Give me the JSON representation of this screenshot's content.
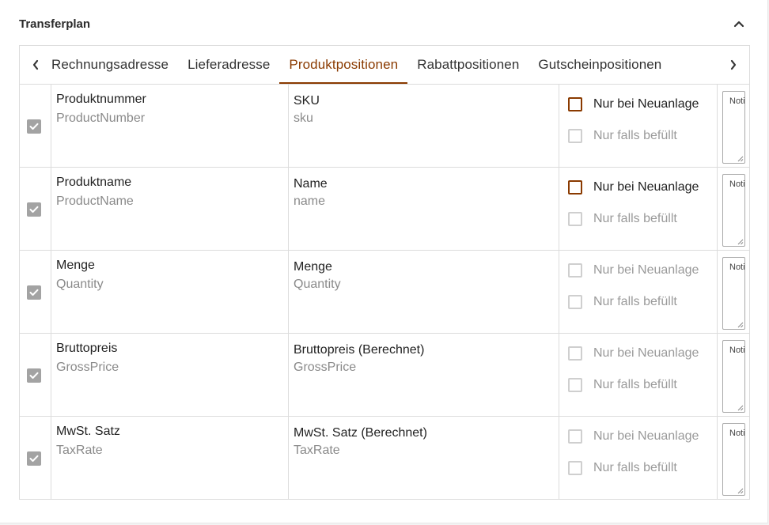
{
  "panel": {
    "title": "Transferplan"
  },
  "tabs": {
    "items": [
      {
        "label": "Rechnungsadresse",
        "active": false
      },
      {
        "label": "Lieferadresse",
        "active": false
      },
      {
        "label": "Produktpositionen",
        "active": true
      },
      {
        "label": "Rabattpositionen",
        "active": false
      },
      {
        "label": "Gutscheinpositionen",
        "active": false
      }
    ]
  },
  "icons": {
    "collapse": "chevron-up-icon",
    "tabs_prev": "chevron-left-icon",
    "tabs_next": "chevron-right-icon",
    "row_check": "checkmark-icon"
  },
  "colors": {
    "accent": "#8a3a00",
    "disabled_check": "#a3a3a3",
    "muted_text": "#8a8a8a",
    "border": "#dcdcdc"
  },
  "rows": [
    {
      "source_label": "Produktnummer",
      "source_key": "ProductNumber",
      "target_label": "SKU",
      "target_key": "sku",
      "opt_new_label": "Nur bei Neuanlage",
      "opt_new_enabled": true,
      "opt_filled_label": "Nur falls befüllt",
      "note_text": "Notiz"
    },
    {
      "source_label": "Produktname",
      "source_key": "ProductName",
      "target_label": "Name",
      "target_key": "name",
      "opt_new_label": "Nur bei Neuanlage",
      "opt_new_enabled": true,
      "opt_filled_label": "Nur falls befüllt",
      "note_text": "Notiz"
    },
    {
      "source_label": "Menge",
      "source_key": "Quantity",
      "target_label": "Menge",
      "target_key": "Quantity",
      "opt_new_label": "Nur bei Neuanlage",
      "opt_new_enabled": false,
      "opt_filled_label": "Nur falls befüllt",
      "note_text": "Notiz"
    },
    {
      "source_label": "Bruttopreis",
      "source_key": "GrossPrice",
      "target_label": "Bruttopreis (Berechnet)",
      "target_key": "GrossPrice",
      "opt_new_label": "Nur bei Neuanlage",
      "opt_new_enabled": false,
      "opt_filled_label": "Nur falls befüllt",
      "note_text": "Notiz"
    },
    {
      "source_label": "MwSt. Satz",
      "source_key": "TaxRate",
      "target_label": "MwSt. Satz (Berechnet)",
      "target_key": "TaxRate",
      "opt_new_label": "Nur bei Neuanlage",
      "opt_new_enabled": false,
      "opt_filled_label": "Nur falls befüllt",
      "note_text": "Notiz"
    }
  ]
}
